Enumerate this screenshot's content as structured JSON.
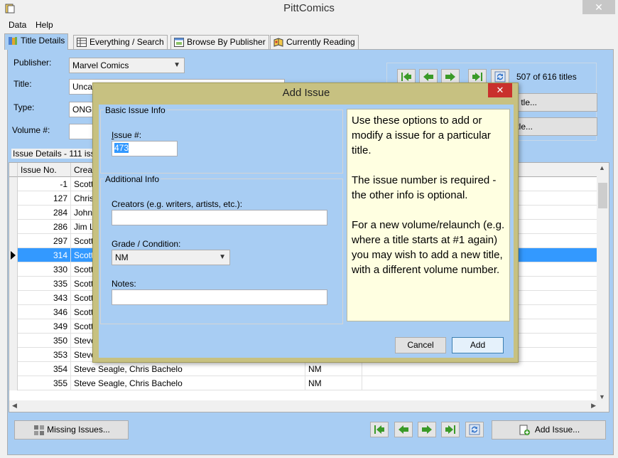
{
  "window": {
    "title": "PittComics",
    "close_glyph": "✕"
  },
  "menu": [
    "Data",
    "Help"
  ],
  "tabs": [
    {
      "label": "Title Details",
      "icon": "book-stack-icon"
    },
    {
      "label": "Everything / Search",
      "icon": "table-grid-icon"
    },
    {
      "label": "Browse By Publisher",
      "icon": "browse-window-icon"
    },
    {
      "label": "Currently Reading",
      "icon": "reading-icon"
    }
  ],
  "form": {
    "publisher_label": "Publisher:",
    "publisher_value": "Marvel Comics",
    "title_label": "Title:",
    "title_value": "Unca",
    "type_label": "Type:",
    "type_value": "ONG",
    "volume_label": "Volume #:",
    "volume_value": ""
  },
  "nav": {
    "count_text": "507 of 616 titles",
    "edit_title_btn": "tle...",
    "delete_title_btn": "tle..."
  },
  "issues": {
    "group_label": "Issue Details - 111 issu",
    "columns": [
      "Issue No.",
      "Creat"
    ],
    "rows": [
      {
        "no": "-1",
        "creators": "Scott",
        "grade": ""
      },
      {
        "no": "127",
        "creators": "Chris",
        "grade": ""
      },
      {
        "no": "284",
        "creators": "John",
        "grade": ""
      },
      {
        "no": "286",
        "creators": "Jim L",
        "grade": ""
      },
      {
        "no": "297",
        "creators": "Scott",
        "grade": ""
      },
      {
        "no": "314",
        "creators": "Scott",
        "grade": ""
      },
      {
        "no": "330",
        "creators": "Scott",
        "grade": ""
      },
      {
        "no": "335",
        "creators": "Scott",
        "grade": ""
      },
      {
        "no": "343",
        "creators": "Scott",
        "grade": ""
      },
      {
        "no": "346",
        "creators": "Scott",
        "grade": ""
      },
      {
        "no": "349",
        "creators": "Scott",
        "grade": ""
      },
      {
        "no": "350",
        "creators": "Steve",
        "grade": ""
      },
      {
        "no": "353",
        "creators": "Steve",
        "grade": ""
      },
      {
        "no": "354",
        "creators": "Steve Seagle, Chris Bachelo",
        "grade": "NM"
      },
      {
        "no": "355",
        "creators": "Steve Seagle, Chris Bachelo",
        "grade": "NM"
      }
    ],
    "selected_row": 5
  },
  "footer": {
    "missing_issues_btn": "Missing Issues...",
    "add_issue_btn": "Add Issue..."
  },
  "dialog": {
    "title": "Add Issue",
    "close_glyph": "✕",
    "basic_legend": "Basic Issue Info",
    "issue_label": "Issue #:",
    "issue_value": "473",
    "additional_legend": "Additional Info",
    "creators_label": "Creators (e.g. writers, artists, etc.):",
    "creators_value": "",
    "grade_label": "Grade / Condition:",
    "grade_value": "NM",
    "notes_label": "Notes:",
    "notes_value": "",
    "help_p1": "Use these options to add or modify a issue for a particular title.",
    "help_p2": "The issue number is required - the other info is optional.",
    "help_p3": "For a new volume/relaunch (e.g. where a title starts at #1 again) you may wish to add a new title, with a different volume number.",
    "cancel_btn": "Cancel",
    "add_btn": "Add"
  },
  "colors": {
    "panel_bg": "#a8cdf3",
    "dialog_frame": "#c7c181",
    "help_bg": "#ffffe1",
    "selection": "#3399ff",
    "nav_arrow": "#3a9a28"
  }
}
